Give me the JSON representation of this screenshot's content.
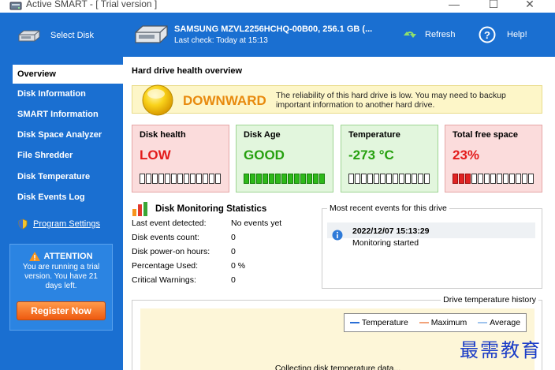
{
  "window": {
    "title": "Active SMART - [ Trial version ]",
    "controls": {
      "minimize": "—",
      "maximize": "☐",
      "close": "✕"
    }
  },
  "toolbar": {
    "select_disk": "Select Disk",
    "drive_name": "SAMSUNG MZVL2256HCHQ-00B00, 256.1 GB (...",
    "last_check": "Last check: Today at 15:13",
    "refresh": "Refresh",
    "help": "Help!"
  },
  "sidebar": {
    "items": [
      {
        "label": "Overview",
        "active": true
      },
      {
        "label": "Disk Information",
        "active": false
      },
      {
        "label": "SMART Information",
        "active": false
      },
      {
        "label": "Disk Space Analyzer",
        "active": false
      },
      {
        "label": "File Shredder",
        "active": false
      },
      {
        "label": "Disk Temperature",
        "active": false
      },
      {
        "label": "Disk Events Log",
        "active": false
      }
    ],
    "settings": "Program Settings",
    "attention": {
      "title": "ATTENTION",
      "message": "You are running a trial version. You have 21 days left.",
      "register": "Register Now"
    }
  },
  "main": {
    "title": "Hard drive health overview",
    "alert": {
      "status": "DOWNWARD",
      "message": "The reliability of this hard drive is low. You may need to backup important information to another hard drive."
    },
    "cards": [
      {
        "label": "Disk health",
        "value": "LOW",
        "tone": "red",
        "fill": 0,
        "fill_color": "none"
      },
      {
        "label": "Disk Age",
        "value": "GOOD",
        "tone": "green",
        "fill": 1,
        "fill_color": "green"
      },
      {
        "label": "Temperature",
        "value": "-273 °C",
        "tone": "green",
        "fill": 0,
        "fill_color": "none"
      },
      {
        "label": "Total free space",
        "value": "23%",
        "tone": "red",
        "fill": 0.23,
        "fill_color": "red"
      }
    ],
    "stats": {
      "title": "Disk Monitoring Statistics",
      "rows": [
        {
          "key": "Last event detected:",
          "value": "No events yet"
        },
        {
          "key": "Disk events count:",
          "value": "0"
        },
        {
          "key": "Disk power-on hours:",
          "value": "0"
        },
        {
          "key": "Percentage Used:",
          "value": "0 %"
        },
        {
          "key": "Critical Warnings:",
          "value": "0"
        }
      ]
    },
    "events": {
      "title": "Most recent events for this drive",
      "items": [
        {
          "time": "2022/12/07 15:13:29",
          "text": "Monitoring started"
        }
      ]
    },
    "temperature": {
      "title": "Drive temperature history",
      "legend": [
        {
          "label": "Temperature",
          "color": "#2a6fd6"
        },
        {
          "label": "Maximum",
          "color": "#f2a37a"
        },
        {
          "label": "Average",
          "color": "#9fc4ee"
        }
      ],
      "status": "Collecting disk temperature data..."
    }
  },
  "watermark": "最需教育"
}
